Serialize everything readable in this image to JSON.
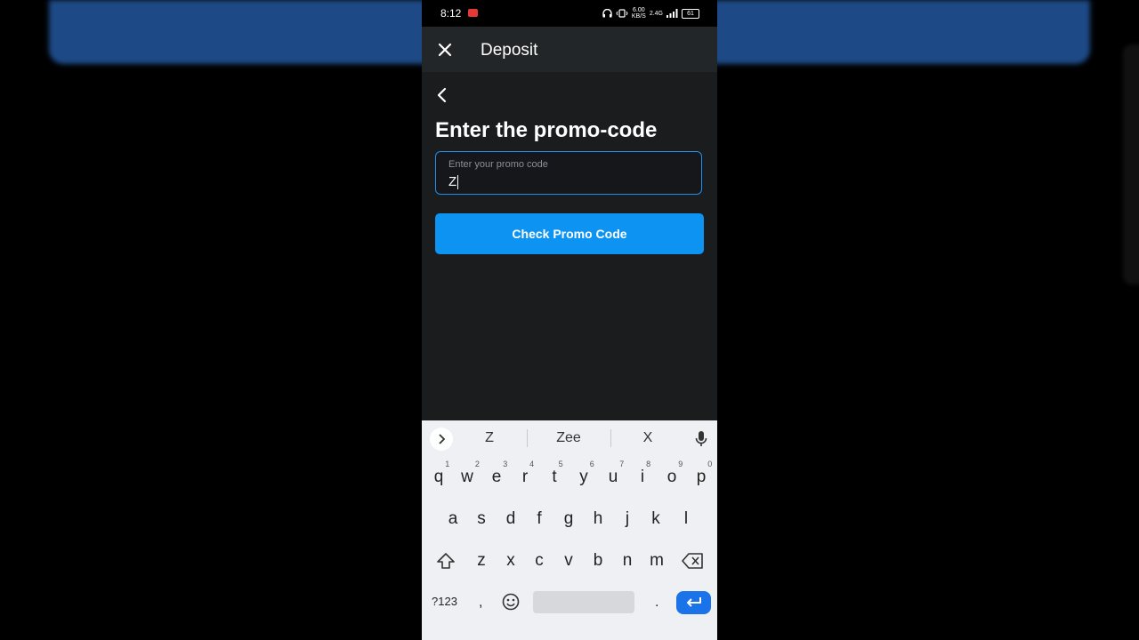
{
  "status": {
    "time": "8:12",
    "speed_value": "6.00",
    "speed_unit": "KB/S",
    "network": "2.4G",
    "battery": "61"
  },
  "appbar": {
    "title": "Deposit"
  },
  "page": {
    "heading": "Enter the promo-code",
    "promo_field": {
      "label": "Enter your promo code",
      "value": "Z"
    },
    "check_button": "Check Promo Code"
  },
  "keyboard": {
    "suggestions": [
      "Z",
      "Zee",
      "X"
    ],
    "row1": [
      {
        "key": "q",
        "hint": "1"
      },
      {
        "key": "w",
        "hint": "2"
      },
      {
        "key": "e",
        "hint": "3"
      },
      {
        "key": "r",
        "hint": "4"
      },
      {
        "key": "t",
        "hint": "5"
      },
      {
        "key": "y",
        "hint": "6"
      },
      {
        "key": "u",
        "hint": "7"
      },
      {
        "key": "i",
        "hint": "8"
      },
      {
        "key": "o",
        "hint": "9"
      },
      {
        "key": "p",
        "hint": "0"
      }
    ],
    "row2": [
      "a",
      "s",
      "d",
      "f",
      "g",
      "h",
      "j",
      "k",
      "l"
    ],
    "row3": [
      "z",
      "x",
      "c",
      "v",
      "b",
      "n",
      "m"
    ],
    "symbols_key": "?123",
    "comma_key": ",",
    "period_key": ".",
    "icons": {
      "expand": "chevron-right-icon",
      "mic": "microphone-icon",
      "shift": "shift-icon",
      "backspace": "backspace-icon",
      "emoji": "emoji-icon",
      "enter": "enter-icon"
    },
    "colors": {
      "background": "#eef0f3",
      "enter": "#1a73e8"
    }
  },
  "colors": {
    "accent": "#0d93f2",
    "field_border": "#1e8ef0",
    "app_background": "#1a1c1e",
    "appbar": "#232629"
  }
}
